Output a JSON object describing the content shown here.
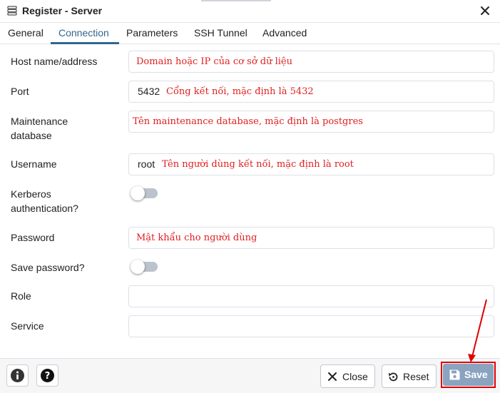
{
  "window": {
    "title": "Register - Server",
    "icon": "server-icon",
    "close_icon": "close-icon"
  },
  "tabs": [
    {
      "label": "General",
      "active": false
    },
    {
      "label": "Connection",
      "active": true
    },
    {
      "label": "Parameters",
      "active": false
    },
    {
      "label": "SSH Tunnel",
      "active": false
    },
    {
      "label": "Advanced",
      "active": false
    }
  ],
  "fields": {
    "host": {
      "label": "Host name/address",
      "value": "",
      "annotation": "Domain hoặc IP của cơ sở dữ liệu"
    },
    "port": {
      "label": "Port",
      "value": "5432",
      "annotation": "Cổng kết nối, mặc định là 5432"
    },
    "maintenance_db": {
      "label_line1": "Maintenance",
      "label_line2": "database",
      "value": "",
      "annotation": "Tên maintenance database, mặc định là postgres"
    },
    "username": {
      "label": "Username",
      "value": "root",
      "annotation": "Tên người dùng kết nối, mặc định là root"
    },
    "kerberos": {
      "label_line1": "Kerberos",
      "label_line2": "authentication?",
      "enabled": false
    },
    "password": {
      "label": "Password",
      "value": "",
      "annotation": "Mật khẩu cho người dùng"
    },
    "save_password": {
      "label": "Save password?",
      "enabled": false
    },
    "role": {
      "label": "Role",
      "value": ""
    },
    "service": {
      "label": "Service",
      "value": ""
    }
  },
  "footer": {
    "info_icon": "info-icon",
    "help_icon": "help-icon",
    "close_label": "Close",
    "reset_label": "Reset",
    "save_label": "Save"
  },
  "colors": {
    "accent": "#326690",
    "annotation": "#e02020",
    "save_button": "#8aa3bf",
    "highlight": "#e00000"
  }
}
